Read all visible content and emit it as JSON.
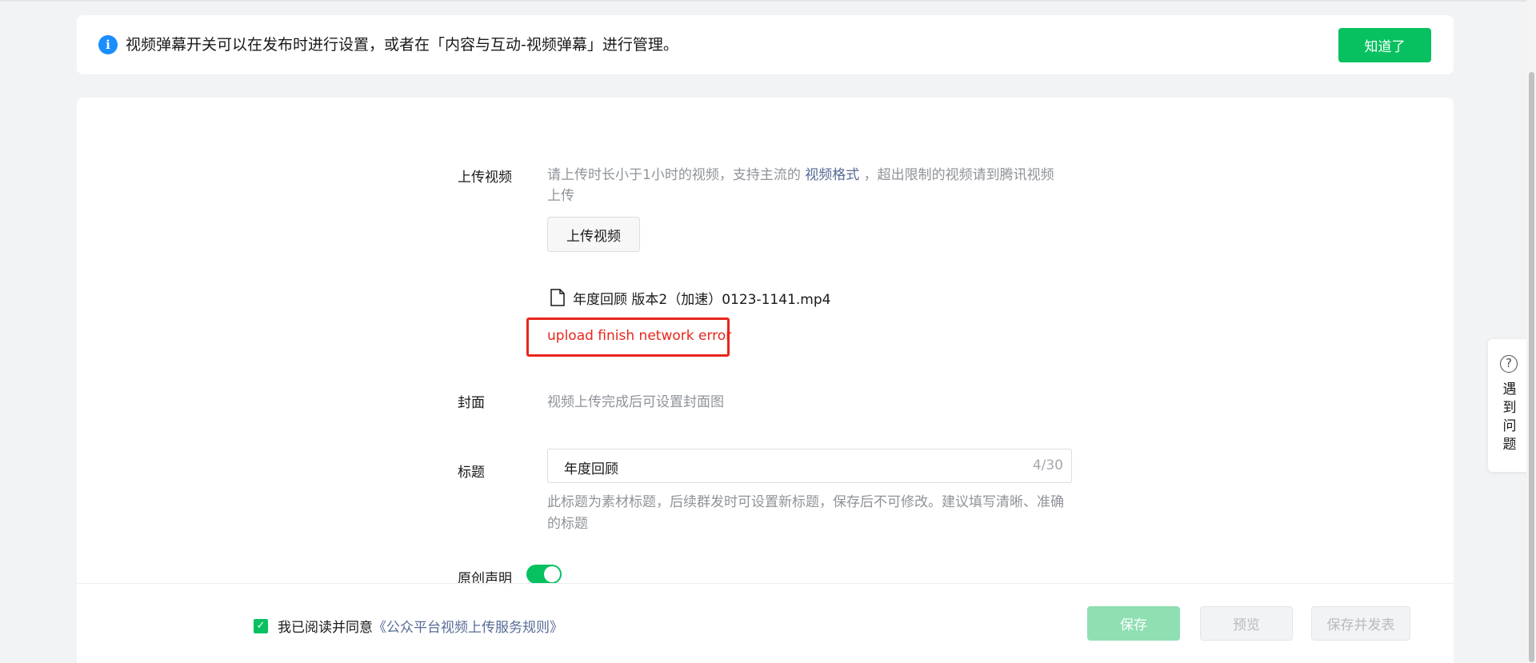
{
  "notice": {
    "icon": "info-icon",
    "text": "视频弹幕开关可以在发布时进行设置，或者在「内容与互动-视频弹幕」进行管理。",
    "ack_label": "知道了"
  },
  "form": {
    "upload": {
      "label": "上传视频",
      "desc_prefix": "请上传时长小于1小时的视频，支持主流的",
      "desc_link": "视频格式",
      "desc_suffix": "，超出限制的视频请到腾讯视频上传",
      "button_label": "上传视频",
      "file_name": "年度回顾 版本2（加速）0123-1141.mp4",
      "error": "upload finish network error"
    },
    "cover": {
      "label": "封面",
      "hint": "视频上传完成后可设置封面图"
    },
    "title": {
      "label": "标题",
      "value": "年度回顾",
      "count": "4/30",
      "hint": "此标题为素材标题，后续群发时可设置新标题，保存后不可修改。建议填写清晰、准确的标题"
    },
    "original": {
      "label": "原创声明",
      "enabled": true
    }
  },
  "footer": {
    "agree_prefix": "我已阅读并同意",
    "agree_link": "《公众平台视频上传服务规则》",
    "save_label": "保存",
    "preview_label": "预览",
    "publish_label": "保存并发表"
  },
  "help": {
    "icon": "question-icon",
    "label": "遇到问题"
  },
  "colors": {
    "accent": "#07c160",
    "error": "#e8251c",
    "link": "#576b95",
    "info": "#1a8dff"
  }
}
